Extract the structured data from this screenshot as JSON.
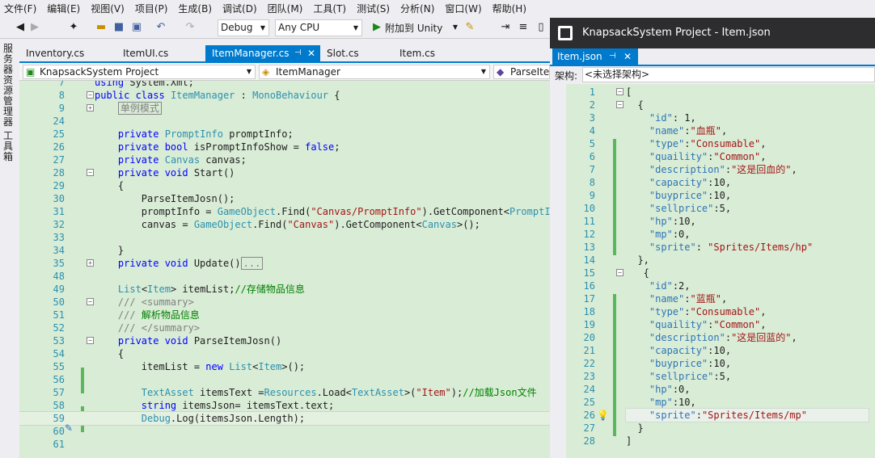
{
  "menu": [
    "文件(F)",
    "编辑(E)",
    "视图(V)",
    "项目(P)",
    "生成(B)",
    "调试(D)",
    "团队(M)",
    "工具(T)",
    "测试(S)",
    "分析(N)",
    "窗口(W)",
    "帮助(H)"
  ],
  "toolbar": {
    "config": "Debug",
    "platform": "Any CPU",
    "attach_label": "附加到 Unity"
  },
  "sidebar": {
    "server_explorer": "服务器资源管理器",
    "toolbox": "工具箱"
  },
  "tabs": [
    {
      "label": "Inventory.cs",
      "active": false
    },
    {
      "label": "ItemUI.cs",
      "active": false
    },
    {
      "label": "ItemManager.cs",
      "active": true
    },
    {
      "label": "Slot.cs",
      "active": false
    },
    {
      "label": "Item.cs",
      "active": false
    }
  ],
  "nav": {
    "project": "KnapsackSystem Project",
    "class": "ItemManager",
    "member": "ParseIte"
  },
  "code_lines": [
    {
      "n": "7",
      "html": "<span class=\"kw\">using</span> System.Xml;"
    },
    {
      "n": "8",
      "html": "<span class=\"kw\">public class</span> <span class=\"ty\">ItemManager</span> : <span class=\"ty\">MonoBehaviour</span> {"
    },
    {
      "n": "9",
      "html": "    <span class=\"collapsed\">单例模式</span>"
    },
    {
      "n": "24",
      "html": ""
    },
    {
      "n": "25",
      "html": "    <span class=\"kw\">private</span> <span class=\"ty\">PromptInfo</span> promptInfo;"
    },
    {
      "n": "26",
      "html": "    <span class=\"kw\">private bool</span> isPromptInfoShow = <span class=\"kw\">false</span>;"
    },
    {
      "n": "27",
      "html": "    <span class=\"kw\">private</span> <span class=\"ty\">Canvas</span> canvas;"
    },
    {
      "n": "28",
      "html": "    <span class=\"kw\">private void</span> Start()"
    },
    {
      "n": "29",
      "html": "    {"
    },
    {
      "n": "30",
      "html": "        ParseItemJosn();"
    },
    {
      "n": "31",
      "html": "        promptInfo = <span class=\"ty\">GameObject</span>.Find(<span class=\"str\">\"Canvas/PromptInfo\"</span>).GetComponent&lt;<span class=\"ty\">PromptInfo</span>&gt;();"
    },
    {
      "n": "32",
      "html": "        canvas = <span class=\"ty\">GameObject</span>.Find(<span class=\"str\">\"Canvas\"</span>).GetComponent&lt;<span class=\"ty\">Canvas</span>&gt;();"
    },
    {
      "n": "33",
      "html": ""
    },
    {
      "n": "34",
      "html": "    }"
    },
    {
      "n": "35",
      "html": "    <span class=\"kw\">private void</span> Update()<span class=\"collapsed\">...</span>"
    },
    {
      "n": "48",
      "html": ""
    },
    {
      "n": "49",
      "html": "    <span class=\"ty\">List</span>&lt;<span class=\"ty\">Item</span>&gt; itemList;<span class=\"cm\">//存储物品信息</span>"
    },
    {
      "n": "50",
      "html": "    <span class=\"gray\">/// &lt;summary&gt;</span>"
    },
    {
      "n": "51",
      "html": "    <span class=\"gray\">///</span> <span class=\"cm\">解析物品信息</span>"
    },
    {
      "n": "52",
      "html": "    <span class=\"gray\">/// &lt;/summary&gt;</span>"
    },
    {
      "n": "53",
      "html": "    <span class=\"kw\">private void</span> ParseItemJosn()"
    },
    {
      "n": "54",
      "html": "    {"
    },
    {
      "n": "55",
      "html": "        itemList = <span class=\"kw\">new</span> <span class=\"ty\">List</span>&lt;<span class=\"ty\">Item</span>&gt;();"
    },
    {
      "n": "56",
      "html": ""
    },
    {
      "n": "57",
      "html": "        <span class=\"ty\">TextAsset</span> itemsText =<span class=\"ty\">Resources</span>.Load&lt;<span class=\"ty\">TextAsset</span>&gt;(<span class=\"str\">\"Item\"</span>);<span class=\"cm\">//加载Json文件</span>"
    },
    {
      "n": "58",
      "html": "        <span class=\"kw\">string</span> itemsJson= itemsText.text;"
    },
    {
      "n": "59",
      "html": "        <span class=\"ty\">Debug</span>.Log(itemsJson.Length);"
    },
    {
      "n": "60",
      "html": ""
    },
    {
      "n": "61",
      "html": ""
    }
  ],
  "json_window": {
    "title": "KnapsackSystem Project - Item.json",
    "tab": "Item.json",
    "schema_label": "架构:",
    "schema_value": "<未选择架构>"
  },
  "json_lines": [
    {
      "n": "1",
      "html": "["
    },
    {
      "n": "2",
      "html": "  {"
    },
    {
      "n": "3",
      "html": "    <span class=\"key\">\"id\"</span>: 1,"
    },
    {
      "n": "4",
      "html": "    <span class=\"key\">\"name\"</span>:<span class=\"sval\">\"血瓶\"</span>,"
    },
    {
      "n": "5",
      "html": "    <span class=\"key\">\"type\"</span>:<span class=\"sval\">\"Consumable\"</span>,"
    },
    {
      "n": "6",
      "html": "    <span class=\"key\">\"quaility\"</span>:<span class=\"sval\">\"Common\"</span>,"
    },
    {
      "n": "7",
      "html": "    <span class=\"key\">\"description\"</span>:<span class=\"sval\">\"这是回血的\"</span>,"
    },
    {
      "n": "8",
      "html": "    <span class=\"key\">\"capacity\"</span>:10,"
    },
    {
      "n": "9",
      "html": "    <span class=\"key\">\"buyprice\"</span>:10,"
    },
    {
      "n": "10",
      "html": "    <span class=\"key\">\"sellprice\"</span>:5,"
    },
    {
      "n": "11",
      "html": "    <span class=\"key\">\"hp\"</span>:10,"
    },
    {
      "n": "12",
      "html": "    <span class=\"key\">\"mp\"</span>:0,"
    },
    {
      "n": "13",
      "html": "    <span class=\"key\">\"sprite\"</span>: <span class=\"sval\">\"Sprites/Items/hp\"</span>"
    },
    {
      "n": "14",
      "html": "  },"
    },
    {
      "n": "15",
      "html": "   {"
    },
    {
      "n": "16",
      "html": "    <span class=\"key\">\"id\"</span>:2,"
    },
    {
      "n": "17",
      "html": "    <span class=\"key\">\"name\"</span>:<span class=\"sval\">\"蓝瓶\"</span>,"
    },
    {
      "n": "18",
      "html": "    <span class=\"key\">\"type\"</span>:<span class=\"sval\">\"Consumable\"</span>,"
    },
    {
      "n": "19",
      "html": "    <span class=\"key\">\"quaility\"</span>:<span class=\"sval\">\"Common\"</span>,"
    },
    {
      "n": "20",
      "html": "    <span class=\"key\">\"description\"</span>:<span class=\"sval\">\"这是回蓝的\"</span>,"
    },
    {
      "n": "21",
      "html": "    <span class=\"key\">\"capacity\"</span>:10,"
    },
    {
      "n": "22",
      "html": "    <span class=\"key\">\"buyprice\"</span>:10,"
    },
    {
      "n": "23",
      "html": "    <span class=\"key\">\"sellprice\"</span>:5,"
    },
    {
      "n": "24",
      "html": "    <span class=\"key\">\"hp\"</span>:0,"
    },
    {
      "n": "25",
      "html": "    <span class=\"key\">\"mp\"</span>:10,"
    },
    {
      "n": "26",
      "html": "    <span class=\"key\">\"sprite\"</span>:<span class=\"sval\">\"Sprites/Items/mp\"</span>"
    },
    {
      "n": "27",
      "html": "  }"
    },
    {
      "n": "28",
      "html": "]"
    }
  ]
}
